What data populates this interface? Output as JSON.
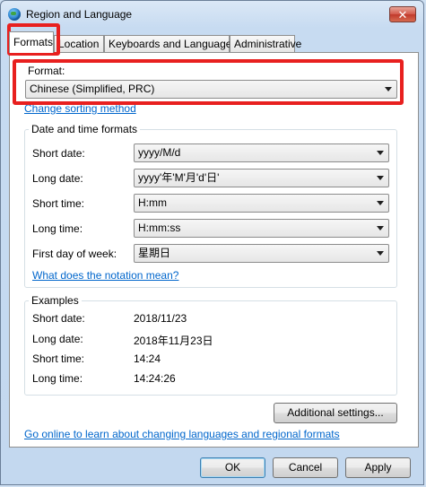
{
  "window": {
    "title": "Region and Language",
    "close_glyph": "✕",
    "app_icon": "globe-icon"
  },
  "tabs": [
    {
      "label": "Formats",
      "active": true
    },
    {
      "label": "Location"
    },
    {
      "label": "Keyboards and Languages"
    },
    {
      "label": "Administrative"
    }
  ],
  "format": {
    "label": "Format:",
    "value": "Chinese (Simplified, PRC)",
    "change_sorting_link": "Change sorting method"
  },
  "datetime": {
    "group_title": "Date and time formats",
    "fields": [
      {
        "label": "Short date:",
        "value": "yyyy/M/d"
      },
      {
        "label": "Long date:",
        "value": "yyyy'年'M'月'd'日'"
      },
      {
        "label": "Short time:",
        "value": "H:mm"
      },
      {
        "label": "Long time:",
        "value": "H:mm:ss"
      },
      {
        "label": "First day of week:",
        "value": "星期日"
      }
    ],
    "notation_link": "What does the notation mean?"
  },
  "examples": {
    "group_title": "Examples",
    "rows": [
      {
        "label": "Short date:",
        "value": "2018/11/23"
      },
      {
        "label": "Long date:",
        "value": "2018年11月23日"
      },
      {
        "label": "Short time:",
        "value": "14:24"
      },
      {
        "label": "Long time:",
        "value": "14:24:26"
      }
    ]
  },
  "additional_settings_label": "Additional settings...",
  "online_link": "Go online to learn about changing languages and regional formats",
  "buttons": {
    "ok": "OK",
    "cancel": "Cancel",
    "apply": "Apply"
  },
  "highlight_color": "#e8201f"
}
